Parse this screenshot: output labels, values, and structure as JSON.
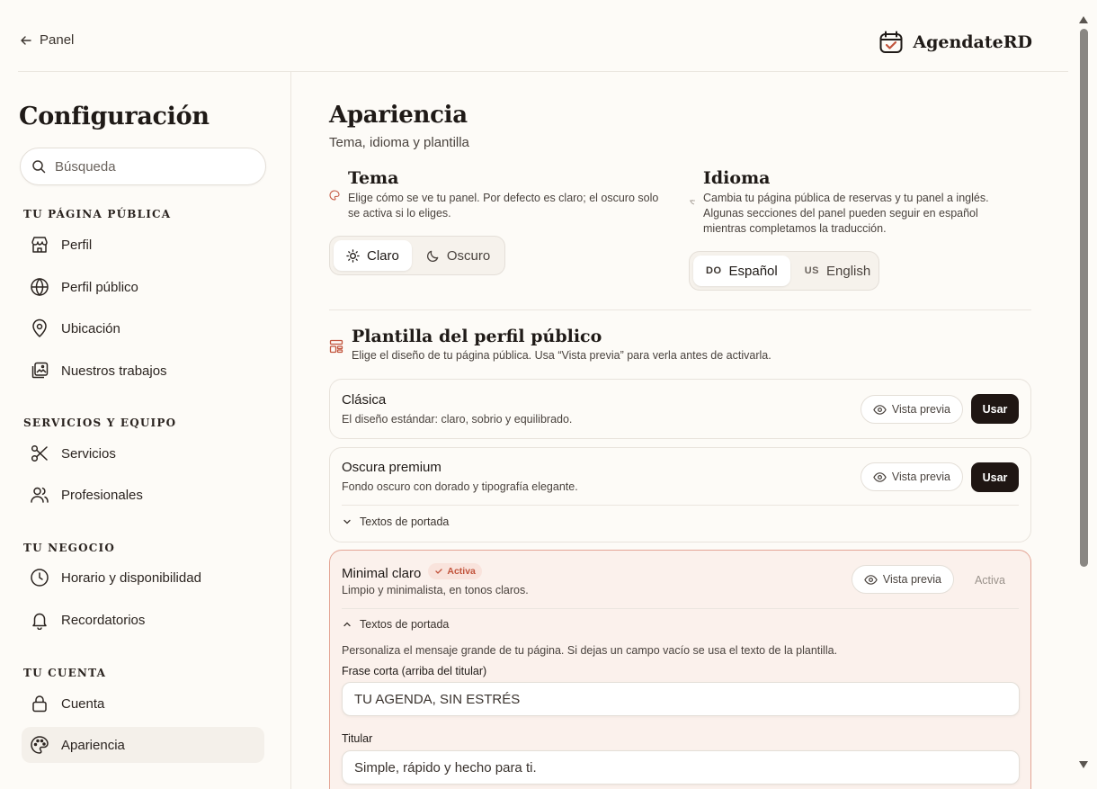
{
  "header": {
    "back_label": "Panel",
    "brand_name": "AgendateRD"
  },
  "sidebar": {
    "title": "Configuración",
    "search_placeholder": "Búsqueda",
    "sections": [
      {
        "heading": "TU PÁGINA PÚBLICA",
        "items": [
          {
            "label": "Perfil",
            "icon": "store-icon"
          },
          {
            "label": "Perfil público",
            "icon": "globe-icon"
          },
          {
            "label": "Ubicación",
            "icon": "map-pin-icon"
          },
          {
            "label": "Nuestros trabajos",
            "icon": "gallery-icon"
          }
        ]
      },
      {
        "heading": "SERVICIOS Y EQUIPO",
        "items": [
          {
            "label": "Servicios",
            "icon": "scissors-icon"
          },
          {
            "label": "Profesionales",
            "icon": "users-icon"
          }
        ]
      },
      {
        "heading": "TU NEGOCIO",
        "items": [
          {
            "label": "Horario y disponibilidad",
            "icon": "clock-icon"
          },
          {
            "label": "Recordatorios",
            "icon": "bell-icon"
          }
        ]
      },
      {
        "heading": "TU CUENTA",
        "items": [
          {
            "label": "Cuenta",
            "icon": "lock-icon"
          },
          {
            "label": "Apariencia",
            "icon": "palette-icon",
            "active": true
          }
        ]
      }
    ]
  },
  "main": {
    "title": "Apariencia",
    "subtitle": "Tema, idioma y plantilla",
    "theme": {
      "title": "Tema",
      "description": "Elige cómo se ve tu panel. Por defecto es claro; el oscuro solo se activa si lo eliges.",
      "options": [
        "Claro",
        "Oscuro"
      ],
      "selected": "Claro"
    },
    "language": {
      "title": "Idioma",
      "description": "Cambia tu página pública de reservas y tu panel a inglés. Algunas secciones del panel pueden seguir en español mientras completamos la traducción.",
      "options": [
        {
          "flag": "DO",
          "label": "Español"
        },
        {
          "flag": "US",
          "label": "English"
        }
      ],
      "selected": "Español"
    },
    "template": {
      "title": "Plantilla del perfil público",
      "description": "Elige el diseño de tu página pública. Usa “Vista previa” para verla antes de activarla.",
      "preview_label": "Vista previa",
      "use_label": "Usar",
      "active_label": "Activa",
      "cards": [
        {
          "name": "Clásica",
          "description": "El diseño estándar: claro, sobrio y equilibrado."
        },
        {
          "name": "Oscura premium",
          "description": "Fondo oscuro con dorado y tipografía elegante.",
          "expander": "Textos de portada"
        },
        {
          "name": "Minimal claro",
          "badge": "Activa",
          "description": "Limpio y minimalista, en tonos claros.",
          "expander": "Textos de portada",
          "help": "Personaliza el mensaje grande de tu página. Si dejas un campo vacío se usa el texto de la plantilla.",
          "fields": [
            {
              "label": "Frase corta (arriba del titular)",
              "value": "TU AGENDA, SIN ESTRÉS"
            },
            {
              "label": "Titular",
              "value": "Simple, rápido y hecho para ti."
            }
          ]
        }
      ]
    }
  },
  "colors": {
    "background": "#fdfbf7",
    "accent": "#c2543c",
    "primary_button": "#1f1613",
    "active_card_bg": "#fbf1ec",
    "active_card_border": "#e4a595"
  }
}
